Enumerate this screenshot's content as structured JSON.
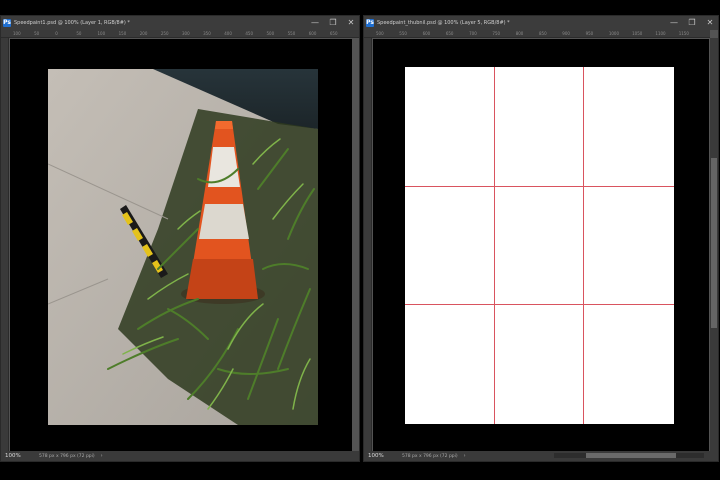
{
  "left_window": {
    "title": "Speedpaint1.psd @ 100% (Layer 1, RGB/8#) *",
    "zoom": "100%",
    "doc_info": "578 px x 796 px (72 ppi)",
    "ruler_ticks": [
      "100",
      "50",
      "0",
      "50",
      "100",
      "150",
      "200",
      "250",
      "300",
      "350",
      "400",
      "450",
      "500",
      "550",
      "600",
      "650"
    ]
  },
  "right_window": {
    "title": "Speedpaint_thubnil.psd @ 100% (Layer 5, RGB/8#) *",
    "zoom": "100%",
    "doc_info": "578 px x 796 px (72 ppi)",
    "ruler_ticks": [
      "500",
      "550",
      "600",
      "650",
      "700",
      "750",
      "800",
      "850",
      "900",
      "950",
      "1000",
      "1050",
      "1100",
      "1150"
    ]
  },
  "window_controls": {
    "minimize": "—",
    "restore": "❐",
    "close": "✕"
  },
  "status_arrow": "›",
  "colors": {
    "app_bg": "#535353",
    "panel": "#3a3a3a",
    "grid_line": "#d9545f",
    "cone_orange": "#e2541f"
  }
}
